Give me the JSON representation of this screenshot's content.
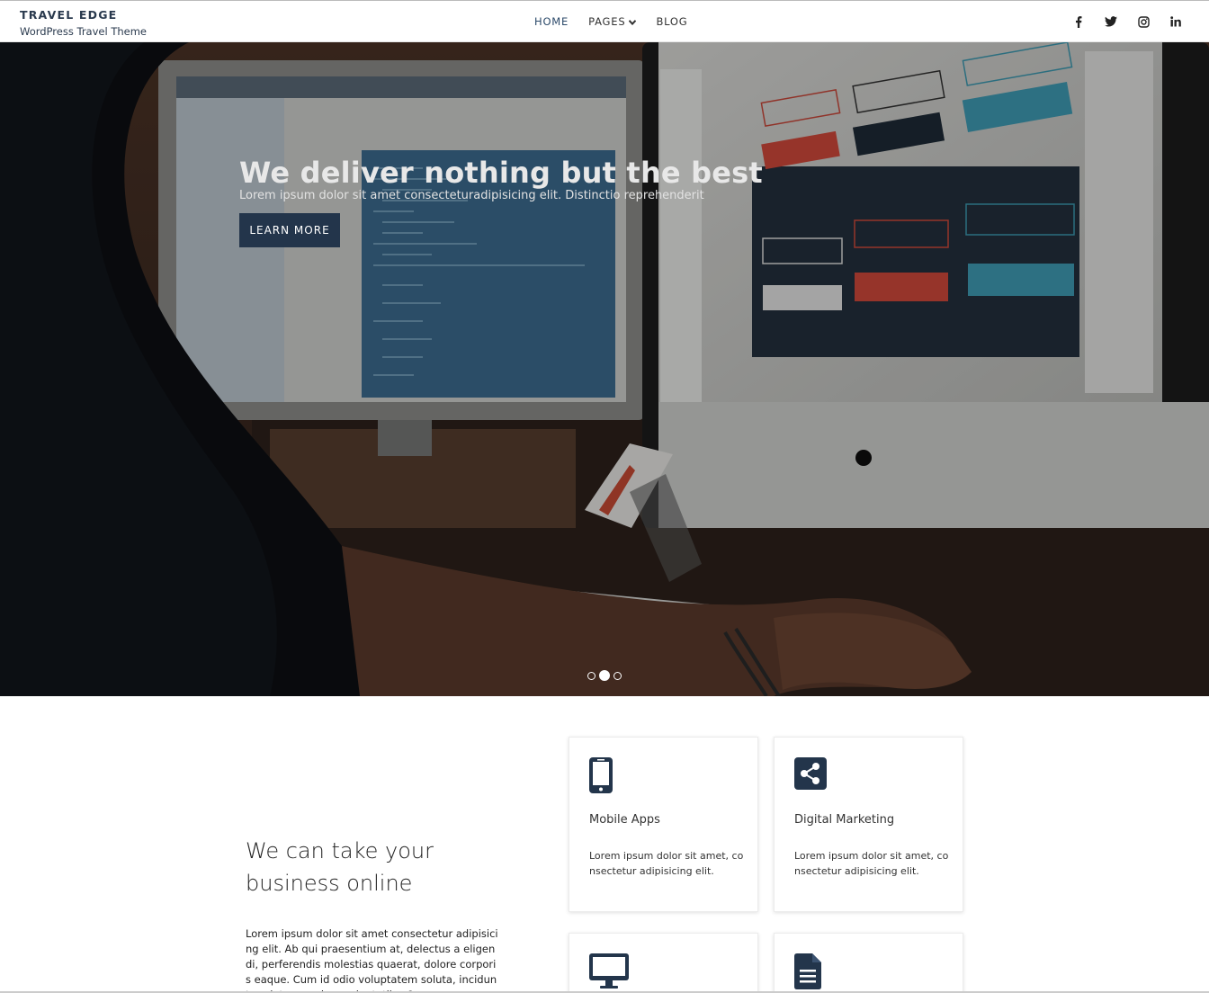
{
  "header": {
    "site_title": "TRAVEL EDGE",
    "tagline": "WordPress Travel Theme",
    "nav": [
      {
        "label": "HOME",
        "active": true
      },
      {
        "label": "PAGES",
        "has_dropdown": true
      },
      {
        "label": "BLOG"
      }
    ],
    "socials": [
      "facebook-icon",
      "twitter-icon",
      "instagram-icon",
      "linkedin-icon"
    ]
  },
  "hero": {
    "title": "We deliver nothing but the best",
    "text": "Lorem ipsum dolor sit amet consecteturadipisicing elit. Distinctio reprehenderit",
    "button_label": "LEARN MORE",
    "slides_count": 3,
    "active_slide": 2
  },
  "intro": {
    "heading_line1": "We can take your",
    "heading_line2": "business online",
    "body": "Lorem ipsum dolor sit amet consectetur adipisicing elit. Ab qui praesentium at, delectus a eligendi, perferendis molestias quaerat, dolore corporis eaque. Cum id odio voluptatem soluta, incidunt pariatur aperiam voluptatibus?"
  },
  "services": [
    {
      "icon": "mobile-icon",
      "title": "Mobile Apps",
      "text": "Lorem ipsum dolor sit amet, consectetur adipisicing elit."
    },
    {
      "icon": "share-icon",
      "title": "Digital Marketing",
      "text": "Lorem ipsum dolor sit amet, consectetur adipisicing elit."
    },
    {
      "icon": "desktop-icon",
      "title": "",
      "text": ""
    },
    {
      "icon": "document-icon",
      "title": "",
      "text": ""
    }
  ],
  "colors": {
    "accent": "#23354b",
    "brand_text": "#2a3a4e"
  }
}
